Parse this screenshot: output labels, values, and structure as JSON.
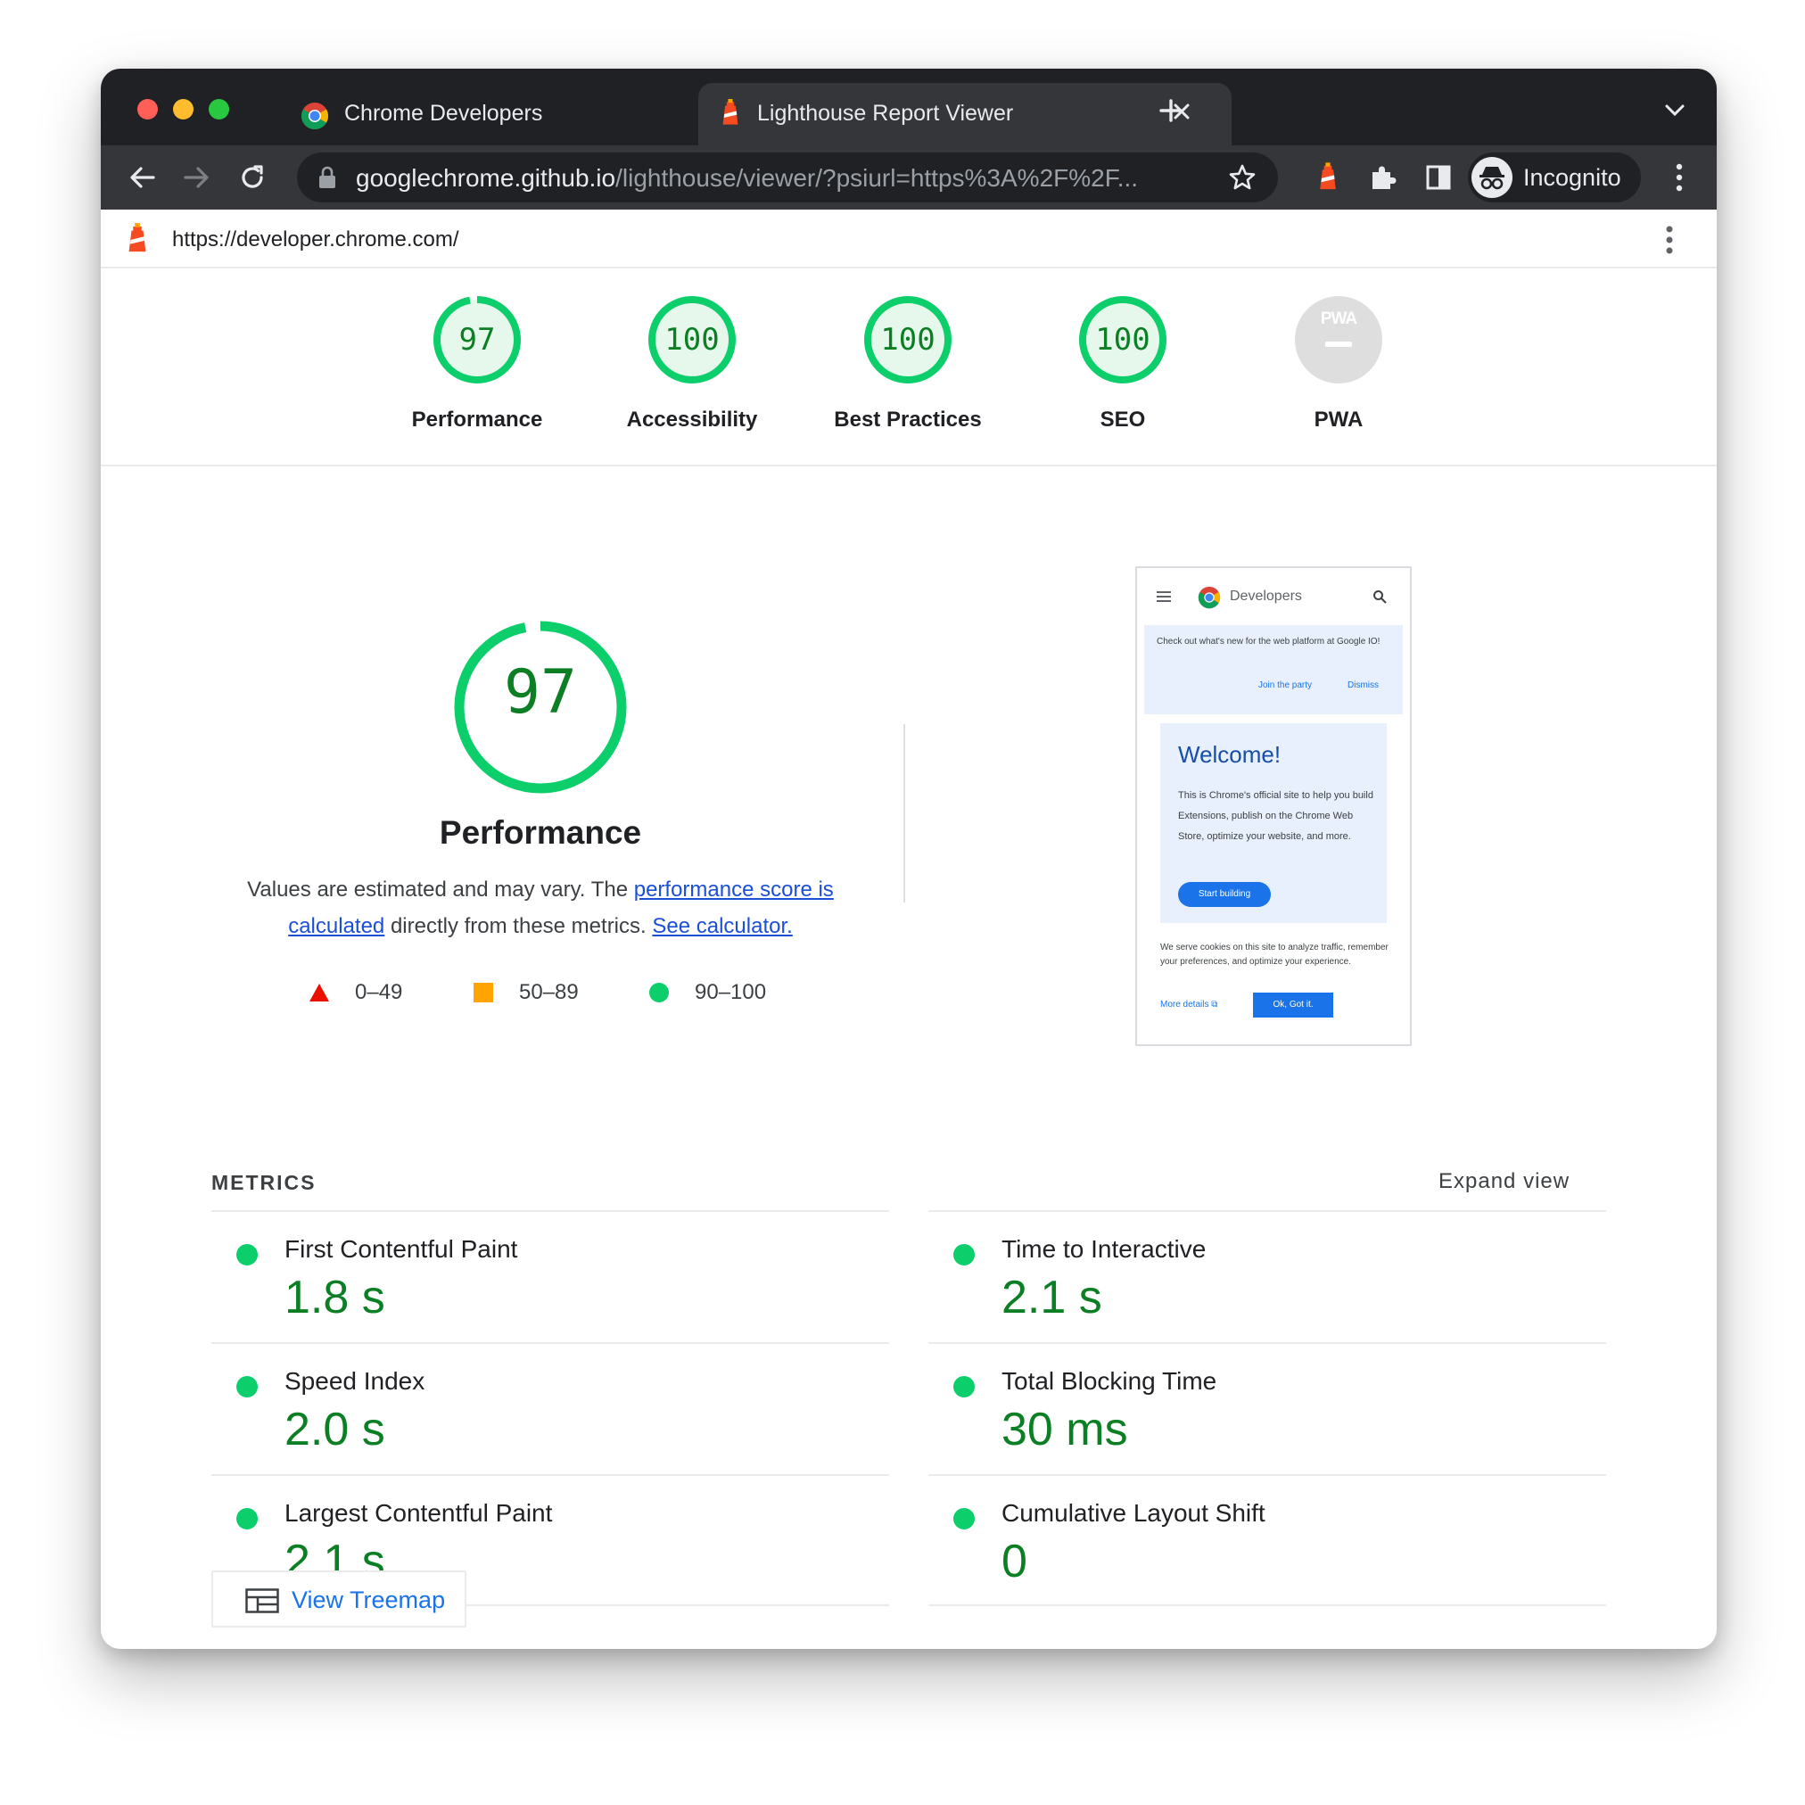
{
  "browser": {
    "tabs": [
      {
        "title": "Chrome Developers",
        "active": false
      },
      {
        "title": "Lighthouse Report Viewer",
        "active": true
      }
    ],
    "url_host": "googlechrome.github.io",
    "url_rest": "/lighthouse/viewer/?psiurl=https%3A%2F%2F...",
    "profile_label": "Incognito"
  },
  "report": {
    "url": "https://developer.chrome.com/"
  },
  "categories": [
    {
      "label": "Performance",
      "score": "97",
      "fraction": 0.97
    },
    {
      "label": "Accessibility",
      "score": "100",
      "fraction": 1.0
    },
    {
      "label": "Best Practices",
      "score": "100",
      "fraction": 1.0
    },
    {
      "label": "SEO",
      "score": "100",
      "fraction": 1.0
    },
    {
      "label": "PWA",
      "badge": "PWA",
      "score": "",
      "fraction": 0
    }
  ],
  "performance": {
    "score": "97",
    "fraction": 0.97,
    "title": "Performance",
    "desc_prefix": "Values are estimated and may vary. The ",
    "desc_link1": "performance score is calculated",
    "desc_middle": " directly from these metrics. ",
    "desc_link2": "See calculator.",
    "legend": [
      {
        "range": "0–49",
        "shape": "triangle",
        "color": "#eb0f00"
      },
      {
        "range": "50–89",
        "shape": "square",
        "color": "#ffa400"
      },
      {
        "range": "90–100",
        "shape": "circle",
        "color": "#0cce6b"
      }
    ]
  },
  "thumbnail": {
    "brand": "Developers",
    "banner_text": "Check out what's new for the web platform at Google IO!",
    "banner_join": "Join the party",
    "banner_dismiss": "Dismiss",
    "welcome": "Welcome!",
    "card_text": "This is Chrome's official site to help you build Extensions, publish on the Chrome Web Store, optimize your website, and more.",
    "start_button": "Start building",
    "cookies_text": "We serve cookies on this site to analyze traffic, remember your preferences, and optimize your experience.",
    "more_details": "More details",
    "ok_button": "Ok, Got it."
  },
  "metrics": {
    "heading": "METRICS",
    "expand_label": "Expand view",
    "items": [
      {
        "title": "First Contentful Paint",
        "value": "1.8 s"
      },
      {
        "title": "Time to Interactive",
        "value": "2.1 s"
      },
      {
        "title": "Speed Index",
        "value": "2.0 s"
      },
      {
        "title": "Total Blocking Time",
        "value": "30 ms"
      },
      {
        "title": "Largest Contentful Paint",
        "value": "2.1 s"
      },
      {
        "title": "Cumulative Layout Shift",
        "value": "0"
      }
    ],
    "treemap_label": "View Treemap"
  },
  "colors": {
    "pass_green": "#0cce6b",
    "pass_text": "#0c7f24",
    "pass_bg": "#e6f8ec",
    "pwa_gray": "#dedede",
    "link": "#1a73e8"
  }
}
